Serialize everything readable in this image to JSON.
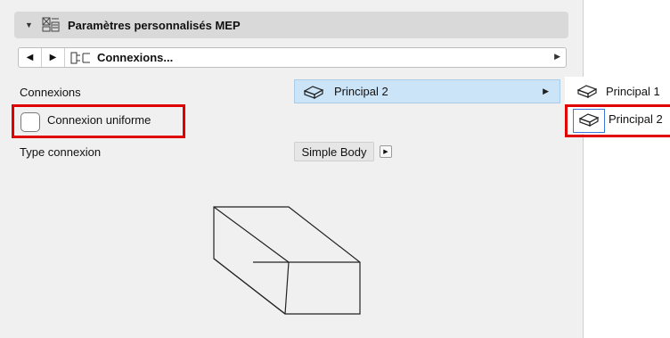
{
  "header": {
    "title": "Paramètres personnalisés MEP",
    "caret_icon": "triangle-down-icon",
    "section_icon": "mep-settings-icon"
  },
  "nav": {
    "prev_icon": "triangle-left-icon",
    "next_icon": "triangle-right-icon",
    "page_icon": "connexions-page-icon",
    "page_label": "Connexions...",
    "dropdown_icon": "triangle-right-small-icon"
  },
  "form": {
    "connexions_label": "Connexions",
    "connexions_value": "Principal 2",
    "uniform_checkbox_label": "Connexion uniforme",
    "uniform_checked": false,
    "type_label": "Type connexion",
    "type_value": "Simple Body"
  },
  "submenu": {
    "items": [
      {
        "label": "Principal 1",
        "icon": "box-outline-icon"
      },
      {
        "label": "Principal 2",
        "icon": "box-outline-icon",
        "selected": true
      }
    ]
  },
  "colors": {
    "panel_bg": "#f0f0f0",
    "header_bg": "#d9d9d9",
    "selection_bg": "#cce4f7",
    "highlight_red": "#e00000",
    "focus_blue": "#3b78d8"
  }
}
